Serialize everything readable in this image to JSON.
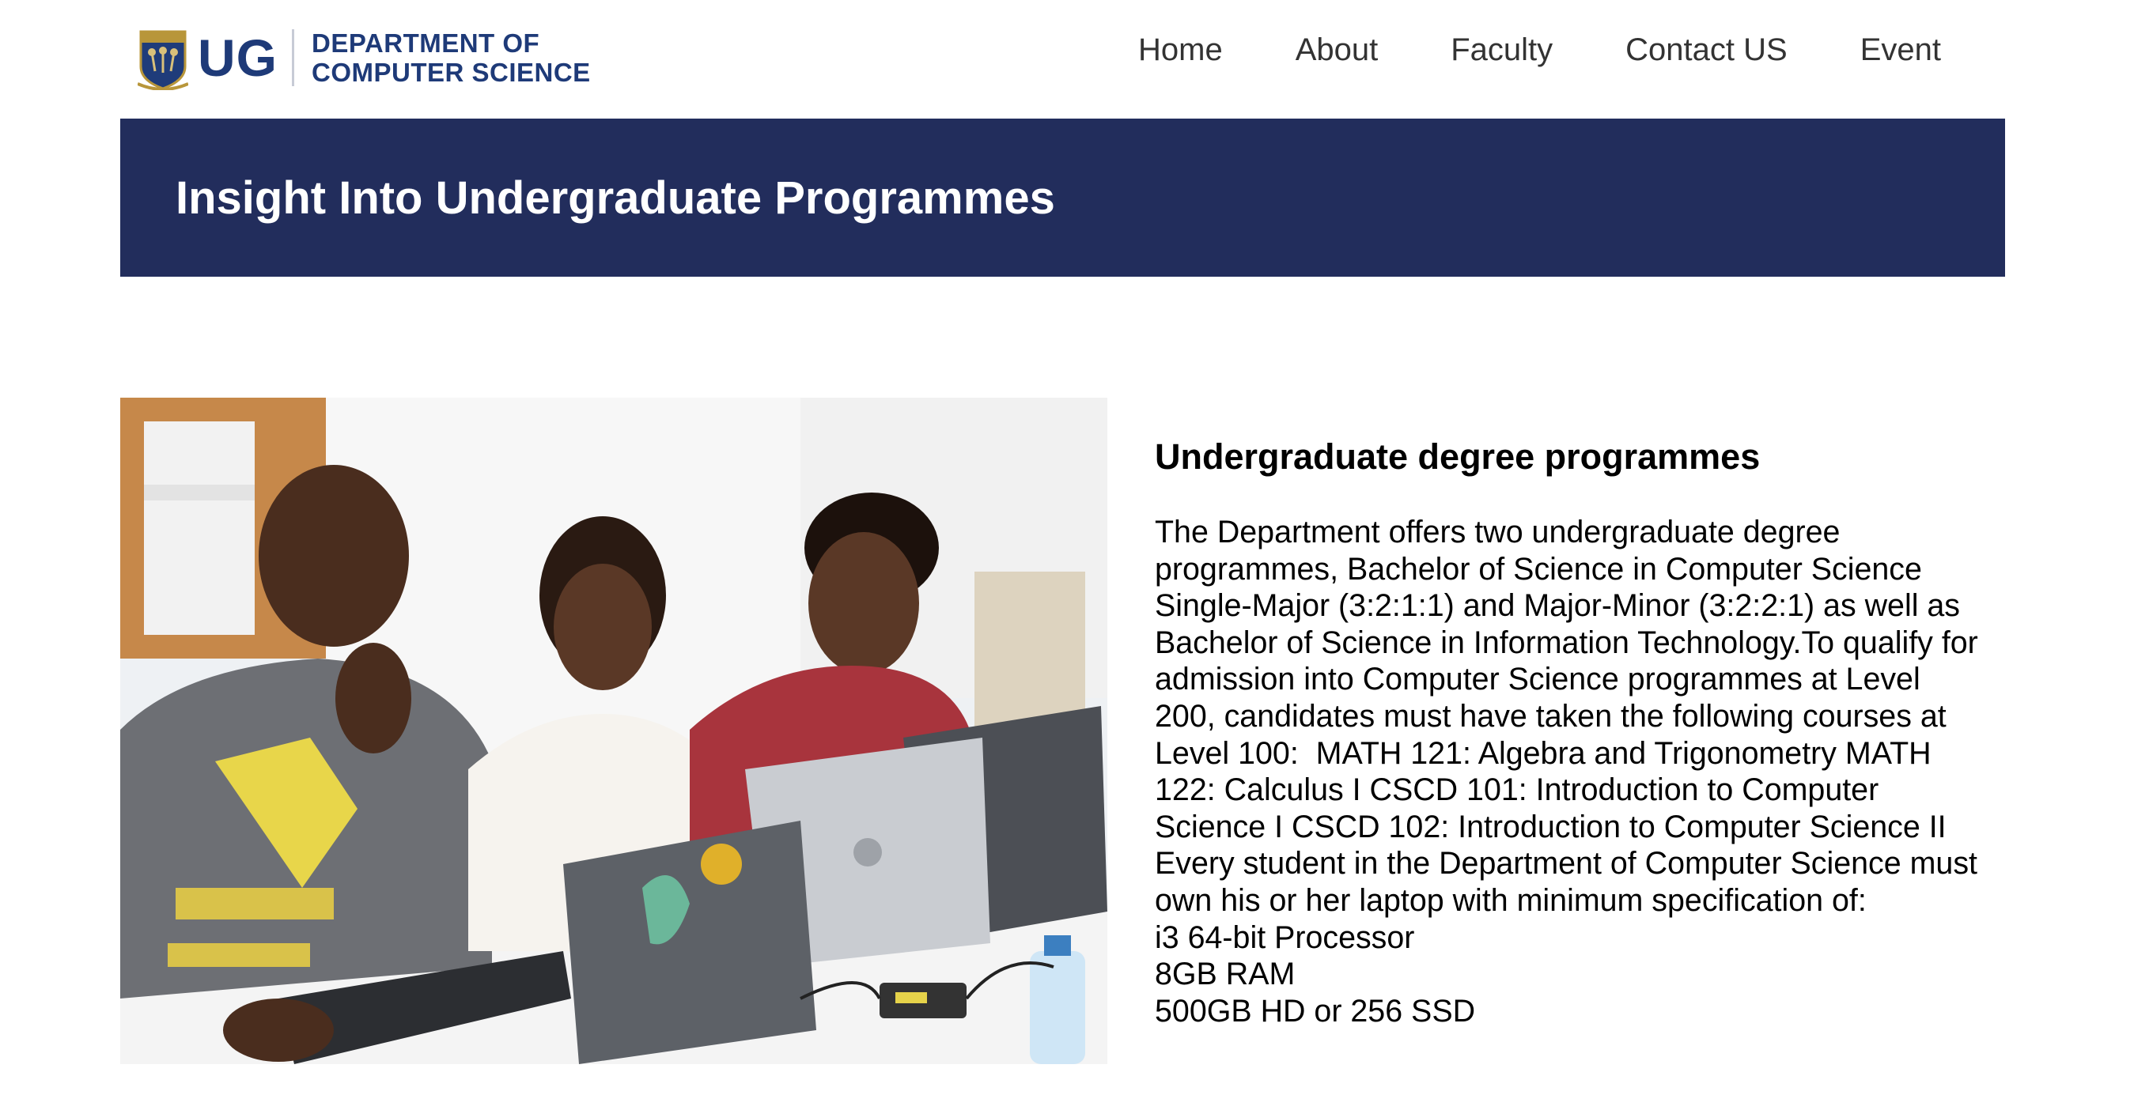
{
  "header": {
    "logo": {
      "short": "UG",
      "dept_line1": "DEPARTMENT OF",
      "dept_line2": "COMPUTER SCIENCE"
    },
    "nav": [
      {
        "label": "Home"
      },
      {
        "label": "About"
      },
      {
        "label": "Faculty"
      },
      {
        "label": "Contact US"
      },
      {
        "label": "Event"
      }
    ]
  },
  "banner": {
    "title": "Insight Into Undergraduate Programmes",
    "background_color": "#222d5c"
  },
  "section": {
    "heading": "Undergraduate degree programmes",
    "paragraph_lines": [
      "The Department offers two undergraduate degree",
      "programmes, Bachelor of Science in Computer Science",
      "Single-Major (3:2:1:1) and Major-Minor (3:2:2:1) as well as",
      "Bachelor of Science in Information Technology.To qualify for",
      "admission into Computer Science programmes at Level",
      "200, candidates must have taken the following courses at",
      "Level 100:  MATH 121: Algebra and Trigonometry MATH",
      "122: Calculus I CSCD 101: Introduction to Computer",
      "Science I CSCD 102: Introduction to Computer Science II",
      "Every student in the Department of Computer Science must",
      "own his or her laptop with minimum specification of:",
      "i3 64-bit Processor",
      "8GB RAM",
      "500GB HD or 256 SSD"
    ]
  },
  "colors": {
    "brand_blue": "#1e3a78",
    "nav_text": "#333333"
  }
}
